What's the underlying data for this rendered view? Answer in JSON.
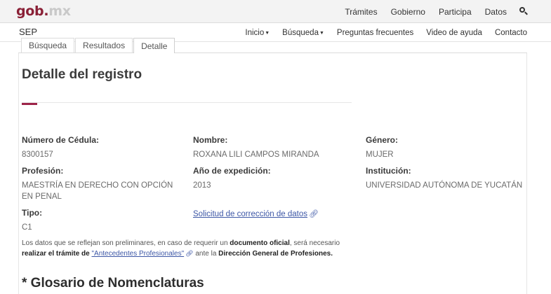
{
  "header": {
    "logo_main": "gob",
    "logo_dot": ".",
    "logo_suffix": "mx",
    "nav": [
      "Trámites",
      "Gobierno",
      "Participa",
      "Datos"
    ]
  },
  "subheader": {
    "brand": "SEP",
    "nav": [
      {
        "label": "Inicio",
        "dropdown": true
      },
      {
        "label": "Búsqueda",
        "dropdown": true
      },
      {
        "label": "Preguntas frecuentes",
        "dropdown": false
      },
      {
        "label": "Video de ayuda",
        "dropdown": false
      },
      {
        "label": "Contacto",
        "dropdown": false
      }
    ]
  },
  "tabs": [
    "Búsqueda",
    "Resultados",
    "Detalle"
  ],
  "active_tab": "Detalle",
  "page_title": "Detalle del registro",
  "fields": {
    "cedula": {
      "label": "Número de Cédula:",
      "value": "8300157"
    },
    "nombre": {
      "label": "Nombre:",
      "value": "ROXANA LILI CAMPOS MIRANDA"
    },
    "genero": {
      "label": "Género:",
      "value": "MUJER"
    },
    "profesion": {
      "label": "Profesión:",
      "value": "MAESTRÍA EN DERECHO CON OPCIÓN EN PENAL"
    },
    "anio": {
      "label": "Año de expedición:",
      "value": "2013"
    },
    "institucion": {
      "label": "Institución:",
      "value": "UNIVERSIDAD AUTÓNOMA DE YUCATÁN"
    },
    "tipo": {
      "label": "Tipo:",
      "value": "C1"
    }
  },
  "correction_link": "Solicitud de corrección de datos",
  "note": {
    "part1": "Los datos que se reflejan son preliminares, en caso de requerir un ",
    "bold1": "documento oficial",
    "part2": ", será necesario ",
    "bold2": "realizar el trámite de ",
    "link": "\"Antecedentes Profesionales\"",
    "part3": " ante la ",
    "bold3": "Dirección General de Profesiones."
  },
  "glossary_title": "* Glosario de Nomenclaturas",
  "colors": {
    "accent": "#9d2449",
    "link": "#3d57a6"
  }
}
